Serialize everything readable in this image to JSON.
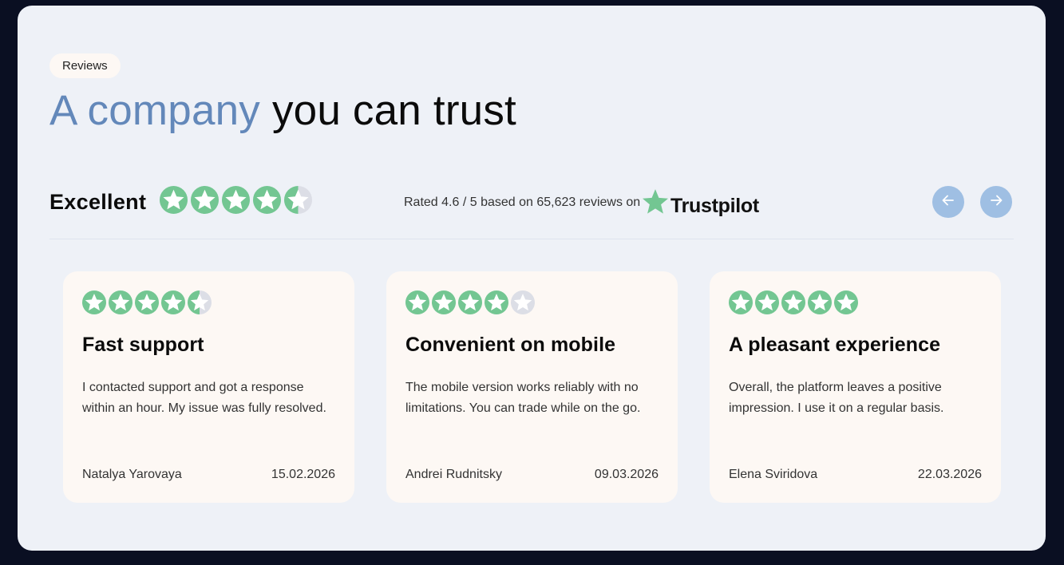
{
  "section": {
    "badge": "Reviews",
    "headline_accent": "A company",
    "headline_rest": " you can trust"
  },
  "summary": {
    "label": "Excellent",
    "rating": 4.5,
    "rated_text": "Rated 4.6 / 5 based on 65,623 reviews on",
    "brand": "Trustpilot"
  },
  "colors": {
    "star_green": "#73c692",
    "star_empty": "#dcdee6",
    "accent_blue": "#6388ba",
    "nav_button": "#9fbfe3"
  },
  "nav": {
    "prev_icon": "arrow-left-icon",
    "next_icon": "arrow-right-icon"
  },
  "reviews": [
    {
      "rating": 4.5,
      "title": "Fast support",
      "text": "I contacted support and got a response within an hour. My issue was fully resolved.",
      "author": "Natalya Yarovaya",
      "date": "15.02.2026"
    },
    {
      "rating": 4,
      "title": "Convenient on mobile",
      "text": "The mobile version works reliably with no limitations. You can trade while on the go.",
      "author": "Andrei Rudnitsky",
      "date": "09.03.2026"
    },
    {
      "rating": 5,
      "title": "A pleasant experience",
      "text": "Overall, the platform leaves a positive impression. I use it on a regular basis.",
      "author": "Elena Sviridova",
      "date": "22.03.2026"
    }
  ]
}
